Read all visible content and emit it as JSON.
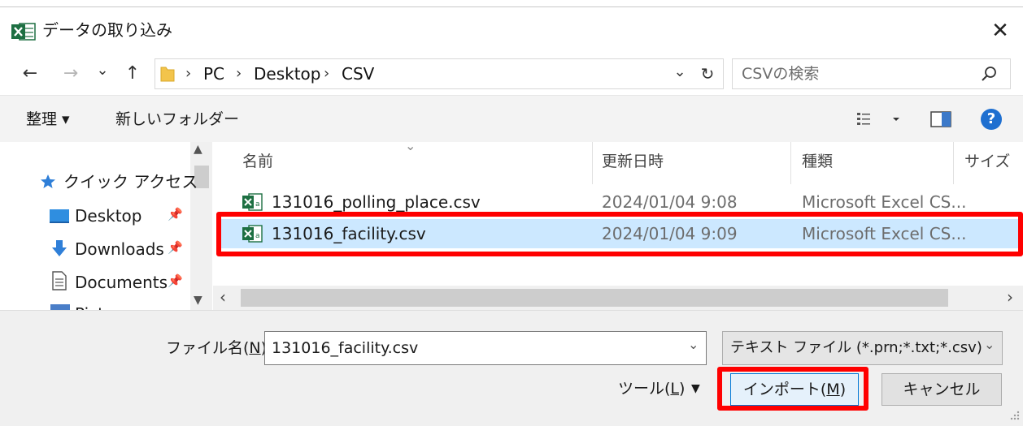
{
  "window": {
    "title": "データの取り込み",
    "app_icon": "excel-icon",
    "close": "✕"
  },
  "nav": {
    "back": "←",
    "forward": "→",
    "recent": "⌄",
    "up": "↑",
    "breadcrumbs": [
      "PC",
      "Desktop",
      "CSV"
    ],
    "dropdown": "⌄",
    "refresh": "↻",
    "search_placeholder": "CSVの検索",
    "search_icon": "search-icon"
  },
  "commands": {
    "organize": "整理 ▾",
    "new_folder": "新しいフォルダー",
    "view_icon": "view-list-icon",
    "preview_icon": "preview-pane-icon",
    "help": "?"
  },
  "sidebar": {
    "items": [
      {
        "label": "クイック アクセス",
        "icon": "star-icon"
      },
      {
        "label": "Desktop",
        "icon": "desktop-icon",
        "pinned": true
      },
      {
        "label": "Downloads",
        "icon": "download-arrow-icon",
        "pinned": true
      },
      {
        "label": "Documents",
        "icon": "document-icon",
        "pinned": true
      },
      {
        "label": "Pict...",
        "icon": "pictures-icon",
        "pinned": true
      }
    ]
  },
  "columns": [
    "名前",
    "更新日時",
    "種類",
    "サイズ"
  ],
  "files": [
    {
      "name": "131016_polling_place.csv",
      "modified": "2024/01/04 9:08",
      "type": "Microsoft Excel CS...",
      "selected": false
    },
    {
      "name": "131016_facility.csv",
      "modified": "2024/01/04 9:09",
      "type": "Microsoft Excel CS...",
      "selected": true
    }
  ],
  "footer": {
    "filename_label_prefix": "ファイル名(",
    "filename_label_key": "N",
    "filename_label_suffix": "):",
    "filename_value": "131016_facility.csv",
    "filter_value": "テキスト ファイル (*.prn;*.txt;*.csv)",
    "tools_prefix": "ツール(",
    "tools_key": "L",
    "tools_suffix": ")",
    "tools_arrow": "▼",
    "import_prefix": "インポート(",
    "import_key": "M",
    "import_suffix": ")",
    "cancel": "キャンセル"
  },
  "colors": {
    "highlight": "#ff0000",
    "selection": "#cce8ff",
    "excel_green": "#1d6f42",
    "help_blue": "#1e6fd0"
  }
}
